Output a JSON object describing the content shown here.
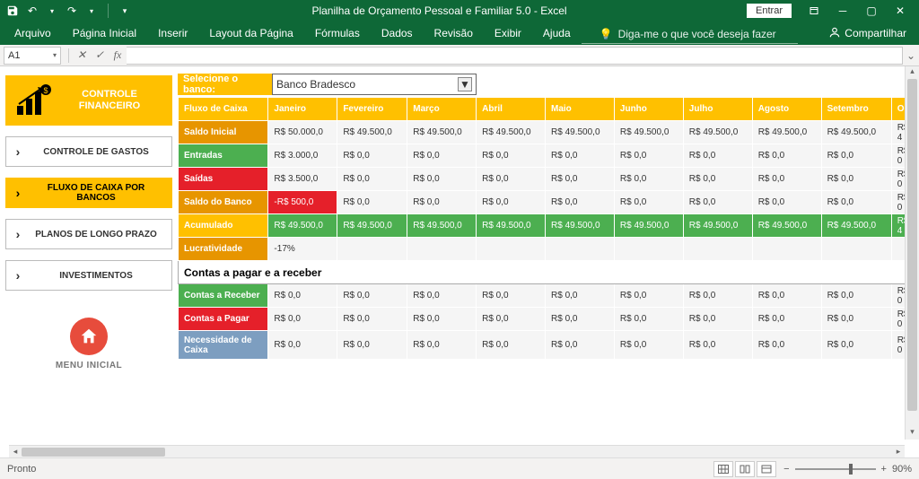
{
  "titlebar": {
    "doc_title": "Planilha de Orçamento Pessoal e Familiar 5.0  -  Excel",
    "entrar": "Entrar"
  },
  "ribbon": {
    "tabs": [
      "Arquivo",
      "Página Inicial",
      "Inserir",
      "Layout da Página",
      "Fórmulas",
      "Dados",
      "Revisão",
      "Exibir",
      "Ajuda"
    ],
    "tellme_placeholder": "Diga-me o que você deseja fazer",
    "compartilhar": "Compartilhar"
  },
  "formula": {
    "name_box": "A1",
    "value": ""
  },
  "sidebar": {
    "header": "CONTROLE FINANCEIRO",
    "items": [
      {
        "label": "CONTROLE DE GASTOS",
        "active": false
      },
      {
        "label": "FLUXO DE CAIXA POR BANCOS",
        "active": true
      },
      {
        "label": "PLANOS DE LONGO PRAZO",
        "active": false
      },
      {
        "label": "INVESTIMENTOS",
        "active": false
      }
    ],
    "home_label": "MENU INICIAL"
  },
  "main": {
    "select_label": "Selecione o banco:",
    "selected_bank": "Banco Bradesco",
    "months": [
      "Janeiro",
      "Fevereiro",
      "Março",
      "Abril",
      "Maio",
      "Junho",
      "Julho",
      "Agosto",
      "Setembro",
      "Out"
    ],
    "cashflow_header": "Fluxo de Caixa",
    "rows": {
      "saldo_inicial": {
        "label": "Saldo Inicial",
        "values": [
          "R$ 50.000,0",
          "R$ 49.500,0",
          "R$ 49.500,0",
          "R$ 49.500,0",
          "R$ 49.500,0",
          "R$ 49.500,0",
          "R$ 49.500,0",
          "R$ 49.500,0",
          "R$ 49.500,0",
          "R$ 4"
        ]
      },
      "entradas": {
        "label": "Entradas",
        "values": [
          "R$ 3.000,0",
          "R$ 0,0",
          "R$ 0,0",
          "R$ 0,0",
          "R$ 0,0",
          "R$ 0,0",
          "R$ 0,0",
          "R$ 0,0",
          "R$ 0,0",
          "R$ 0"
        ]
      },
      "saidas": {
        "label": "Saídas",
        "values": [
          "R$ 3.500,0",
          "R$ 0,0",
          "R$ 0,0",
          "R$ 0,0",
          "R$ 0,0",
          "R$ 0,0",
          "R$ 0,0",
          "R$ 0,0",
          "R$ 0,0",
          "R$ 0"
        ]
      },
      "saldo_banco": {
        "label": "Saldo do Banco",
        "values": [
          "-R$ 500,0",
          "R$ 0,0",
          "R$ 0,0",
          "R$ 0,0",
          "R$ 0,0",
          "R$ 0,0",
          "R$ 0,0",
          "R$ 0,0",
          "R$ 0,0",
          "R$ 0"
        ]
      },
      "acumulado": {
        "label": "Acumulado",
        "values": [
          "R$ 49.500,0",
          "R$ 49.500,0",
          "R$ 49.500,0",
          "R$ 49.500,0",
          "R$ 49.500,0",
          "R$ 49.500,0",
          "R$ 49.500,0",
          "R$ 49.500,0",
          "R$ 49.500,0",
          "R$ 4"
        ]
      },
      "lucratividade": {
        "label": "Lucratividade",
        "values": [
          "-17%",
          "",
          "",
          "",
          "",
          "",
          "",
          "",
          "",
          ""
        ]
      }
    },
    "section2_title": "Contas a pagar e a receber",
    "rows2": {
      "receber": {
        "label": "Contas a Receber",
        "values": [
          "R$ 0,0",
          "R$ 0,0",
          "R$ 0,0",
          "R$ 0,0",
          "R$ 0,0",
          "R$ 0,0",
          "R$ 0,0",
          "R$ 0,0",
          "R$ 0,0",
          "R$ 0"
        ]
      },
      "pagar": {
        "label": "Contas a Pagar",
        "values": [
          "R$ 0,0",
          "R$ 0,0",
          "R$ 0,0",
          "R$ 0,0",
          "R$ 0,0",
          "R$ 0,0",
          "R$ 0,0",
          "R$ 0,0",
          "R$ 0,0",
          "R$ 0"
        ]
      },
      "necess": {
        "label": "Necessidade de Caixa",
        "values": [
          "R$ 0,0",
          "R$ 0,0",
          "R$ 0,0",
          "R$ 0,0",
          "R$ 0,0",
          "R$ 0,0",
          "R$ 0,0",
          "R$ 0,0",
          "R$ 0,0",
          "R$ 0"
        ]
      }
    }
  },
  "statusbar": {
    "ready": "Pronto",
    "zoom": "90%"
  }
}
